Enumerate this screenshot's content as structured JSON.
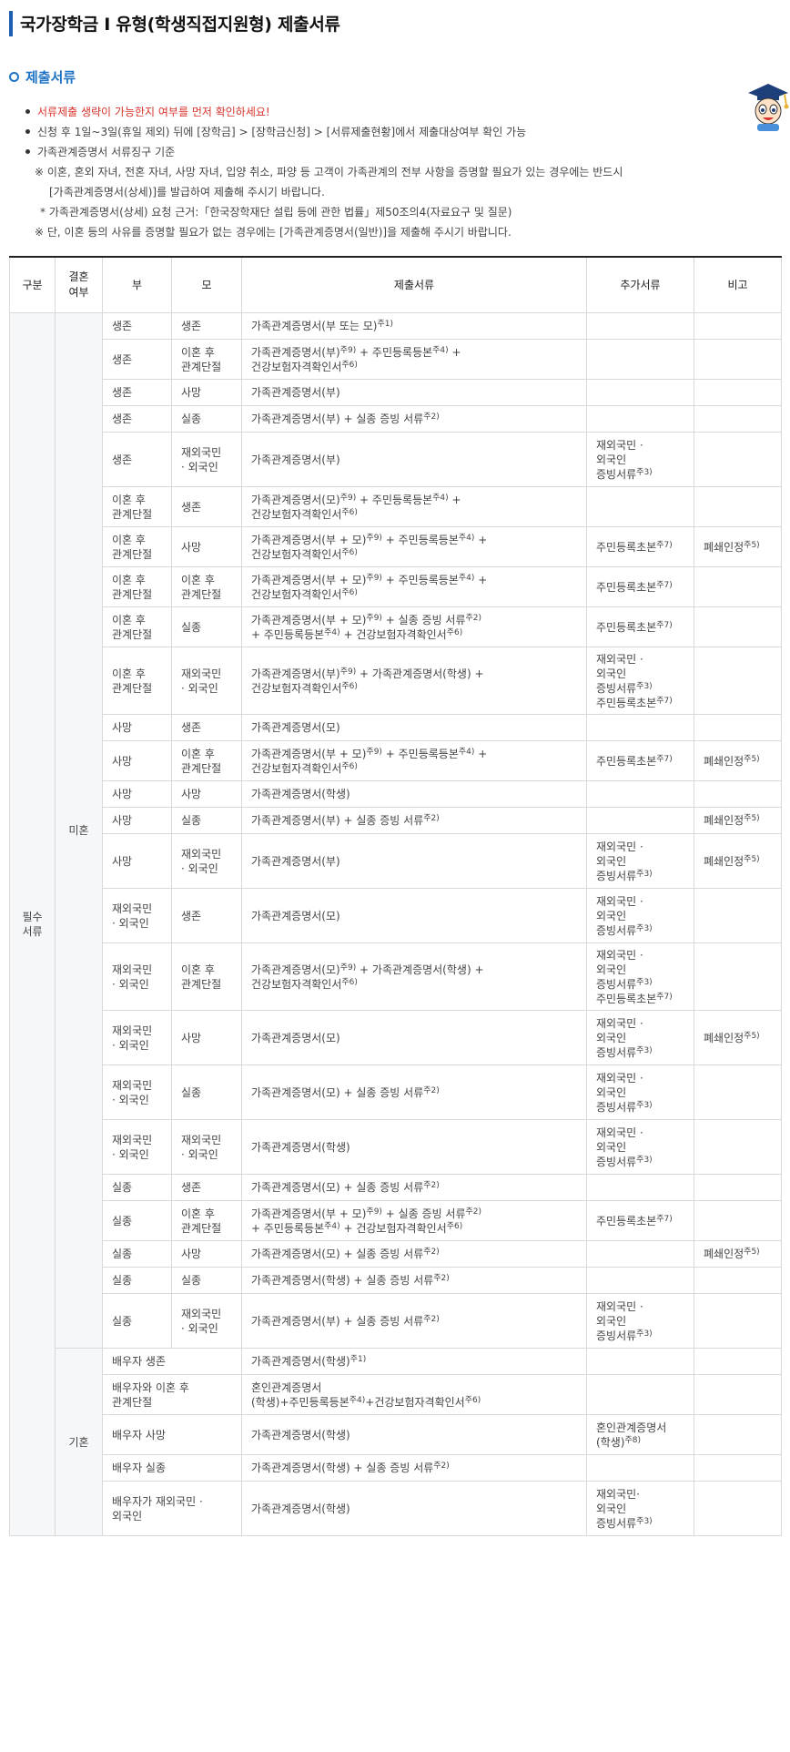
{
  "page": {
    "title": "국가장학금 I 유형(학생직접지원형) 제출서류",
    "section_title": "제출서류"
  },
  "notes": [
    {
      "text": "서류제출 생략이 가능한지 여부를 먼저 확인하세요!",
      "style": "red"
    },
    {
      "text": "신청 후 1일~3일(휴일 제외) 뒤에 [장학금] > [장학금신청] > [서류제출현황]에서 제출대상여부 확인 가능",
      "style": "bullet"
    },
    {
      "text": "가족관계증명서 서류징구 기준",
      "style": "bullet"
    },
    {
      "text": "※ 이혼, 혼외 자녀, 전혼 자녀, 사망 자녀, 입양 취소, 파양 등 고객이 가족관계의 전부 사항을 증명할 필요가 있는 경우에는 반드시",
      "style": "ind1"
    },
    {
      "text": "[가족관계증명서(상세)]를 발급하여 제출해 주시기 바랍니다.",
      "style": "ind2"
    },
    {
      "text": "* 가족관계증명서(상세) 요청 근거:「한국장학재단 설립 등에 관한 법률」제50조의4(자료요구 및 질문)",
      "style": "ind3"
    },
    {
      "text": "※ 단, 이혼 등의 사유를 증명할 필요가 없는 경우에는 [가족관계증명서(일반)]을 제출해 주시기 바랍니다.",
      "style": "ind1"
    }
  ],
  "table": {
    "headers": {
      "category": "구분",
      "marital": "결혼\n여부",
      "father": "부",
      "mother": "모",
      "documents": "제출서류",
      "extra": "추가서류",
      "remarks": "비고"
    },
    "category_label": "필수\n서류",
    "marital_unmarried": "미혼",
    "marital_married": "기혼",
    "rows": [
      {
        "f": "생존",
        "m": "생존",
        "d": "가족관계증명서(부 또는 모)^주1)",
        "e": "",
        "r": ""
      },
      {
        "f": "생존",
        "m": "이혼 후\n관계단절",
        "d": "가족관계증명서(부)^주9) + 주민등록등본^주4) +\n건강보험자격확인서^주6)",
        "e": "",
        "r": ""
      },
      {
        "f": "생존",
        "m": "사망",
        "d": "가족관계증명서(부)",
        "e": "",
        "r": ""
      },
      {
        "f": "생존",
        "m": "실종",
        "d": "가족관계증명서(부) + 실종 증빙 서류^주2)",
        "e": "",
        "r": ""
      },
      {
        "f": "생존",
        "m": "재외국민\n· 외국인",
        "d": "가족관계증명서(부)",
        "e": "재외국민 ·\n외국인\n증빙서류^주3)",
        "r": ""
      },
      {
        "f": "이혼 후\n관계단절",
        "m": "생존",
        "d": "가족관계증명서(모)^주9) + 주민등록등본^주4) +\n건강보험자격확인서^주6)",
        "e": "",
        "r": ""
      },
      {
        "f": "이혼 후\n관계단절",
        "m": "사망",
        "d": "가족관계증명서(부 + 모)^주9) + 주민등록등본^주4) +\n건강보험자격확인서^주6)",
        "e": "주민등록초본^주7)",
        "r": "폐쇄인정^주5)"
      },
      {
        "f": "이혼 후\n관계단절",
        "m": "이혼 후\n관계단절",
        "d": "가족관계증명서(부 + 모)^주9) + 주민등록등본^주4) +\n건강보험자격확인서^주6)",
        "e": "주민등록초본^주7)",
        "r": ""
      },
      {
        "f": "이혼 후\n관계단절",
        "m": "실종",
        "d": "가족관계증명서(부 + 모)^주9) + 실종 증빙 서류^주2)\n+ 주민등록등본^주4) + 건강보험자격확인서^주6)",
        "e": "주민등록초본^주7)",
        "r": ""
      },
      {
        "f": "이혼 후\n관계단절",
        "m": "재외국민\n· 외국인",
        "d": "가족관계증명서(부)^주9) + 가족관계증명서(학생) +\n건강보험자격확인서^주6)",
        "e": "재외국민 ·\n외국인\n증빙서류^주3)\n주민등록초본^주7)",
        "r": ""
      },
      {
        "f": "사망",
        "m": "생존",
        "d": "가족관계증명서(모)",
        "e": "",
        "r": ""
      },
      {
        "f": "사망",
        "m": "이혼 후\n관계단절",
        "d": "가족관계증명서(부 + 모)^주9) + 주민등록등본^주4) +\n건강보험자격확인서^주6)",
        "e": "주민등록초본^주7)",
        "r": "폐쇄인정^주5)"
      },
      {
        "f": "사망",
        "m": "사망",
        "d": "가족관계증명서(학생)",
        "e": "",
        "r": ""
      },
      {
        "f": "사망",
        "m": "실종",
        "d": "가족관계증명서(부) + 실종 증빙 서류^주2)",
        "e": "",
        "r": "폐쇄인정^주5)"
      },
      {
        "f": "사망",
        "m": "재외국민\n· 외국인",
        "d": "가족관계증명서(부)",
        "e": "재외국민 ·\n외국인\n증빙서류^주3)",
        "r": "폐쇄인정^주5)"
      },
      {
        "f": "재외국민\n· 외국인",
        "m": "생존",
        "d": "가족관계증명서(모)",
        "e": "재외국민 ·\n외국인\n증빙서류^주3)",
        "r": ""
      },
      {
        "f": "재외국민\n· 외국인",
        "m": "이혼 후\n관계단절",
        "d": "가족관계증명서(모)^주9) + 가족관계증명서(학생) +\n건강보험자격확인서^주6)",
        "e": "재외국민 ·\n외국인\n증빙서류^주3)\n주민등록초본^주7)",
        "r": ""
      },
      {
        "f": "재외국민\n· 외국인",
        "m": "사망",
        "d": "가족관계증명서(모)",
        "e": "재외국민 ·\n외국인\n증빙서류^주3)",
        "r": "폐쇄인정^주5)"
      },
      {
        "f": "재외국민\n· 외국인",
        "m": "실종",
        "d": "가족관계증명서(모) + 실종 증빙 서류^주2)",
        "e": "재외국민 ·\n외국인\n증빙서류^주3)",
        "r": ""
      },
      {
        "f": "재외국민\n· 외국인",
        "m": "재외국민\n· 외국인",
        "d": "가족관계증명서(학생)",
        "e": "재외국민 ·\n외국인\n증빙서류^주3)",
        "r": ""
      },
      {
        "f": "실종",
        "m": "생존",
        "d": "가족관계증명서(모) + 실종 증빙 서류^주2)",
        "e": "",
        "r": ""
      },
      {
        "f": "실종",
        "m": "이혼 후\n관계단절",
        "d": "가족관계증명서(부 + 모)^주9) + 실종 증빙 서류^주2)\n+ 주민등록등본^주4) + 건강보험자격확인서^주6)",
        "e": "주민등록초본^주7)",
        "r": ""
      },
      {
        "f": "실종",
        "m": "사망",
        "d": "가족관계증명서(모) + 실종 증빙 서류^주2)",
        "e": "",
        "r": "폐쇄인정^주5)"
      },
      {
        "f": "실종",
        "m": "실종",
        "d": "가족관계증명서(학생) + 실종 증빙 서류^주2)",
        "e": "",
        "r": ""
      },
      {
        "f": "실종",
        "m": "재외국민\n· 외국인",
        "d": "가족관계증명서(부) + 실종 증빙 서류^주2)",
        "e": "재외국민 ·\n외국인\n증빙서류^주3)",
        "r": ""
      }
    ],
    "married_rows": [
      {
        "p": "배우자 생존",
        "d": "가족관계증명서(학생)^주1)",
        "e": "",
        "r": ""
      },
      {
        "p": "배우자와 이혼 후\n관계단절",
        "d": "혼인관계증명서\n(학생)+주민등록등본^주4)+건강보험자격확인서^주6)",
        "e": "",
        "r": ""
      },
      {
        "p": "배우자 사망",
        "d": "가족관계증명서(학생)",
        "e": "혼인관계증명서\n(학생)^주8)",
        "r": ""
      },
      {
        "p": "배우자 실종",
        "d": "가족관계증명서(학생) + 실종 증빙 서류^주2)",
        "e": "",
        "r": ""
      },
      {
        "p": "배우자가 재외국민 ·\n외국인",
        "d": "가족관계증명서(학생)",
        "e": "재외국민·\n외국인\n증빙서류^주3)",
        "r": ""
      }
    ]
  },
  "colors": {
    "accent": "#1f73c4",
    "title_bar": "#1f5fb0",
    "warning": "#d8342d",
    "label_bg": "#f6f7f9",
    "border": "#d9d9d9"
  }
}
